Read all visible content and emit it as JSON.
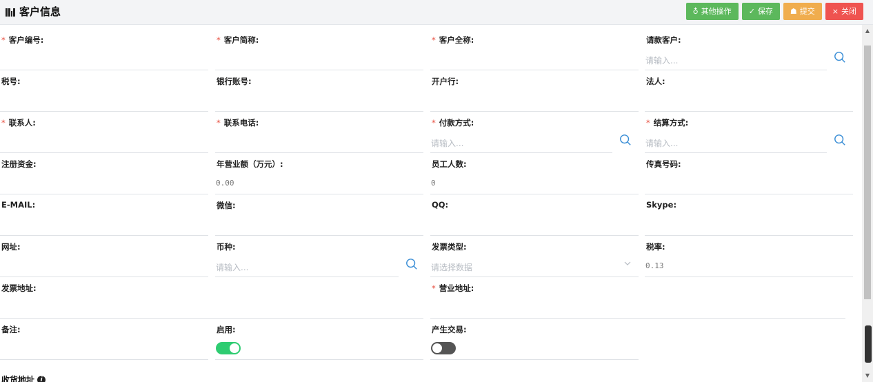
{
  "header": {
    "title": "客户信息",
    "buttons": [
      {
        "name": "other-actions-button",
        "icon": "thumb-icon",
        "glyph": "♁",
        "label": "其他操作",
        "color": "#5cb85c"
      },
      {
        "name": "save-button",
        "icon": "check-icon",
        "glyph": "✓",
        "label": "保存",
        "color": "#5cb85c"
      },
      {
        "name": "submit-button",
        "icon": "doc-icon",
        "glyph": "☗",
        "label": "提交",
        "color": "#f0ad4e"
      },
      {
        "name": "close-button",
        "icon": "close-icon",
        "glyph": "×",
        "label": "关闭",
        "color": "#ef5350"
      }
    ]
  },
  "fields": {
    "customer_code": {
      "label": "客户编号:",
      "required": true
    },
    "customer_short": {
      "label": "客户简称:",
      "required": true
    },
    "customer_full": {
      "label": "客户全称:",
      "required": true
    },
    "billing_customer": {
      "label": "请款客户:",
      "placeholder": "请输入..."
    },
    "tax_no": {
      "label": "税号:"
    },
    "bank_account": {
      "label": "银行账号:"
    },
    "bank": {
      "label": "开户行:"
    },
    "legal_person": {
      "label": "法人:"
    },
    "contact": {
      "label": "联系人:",
      "required": true
    },
    "contact_phone": {
      "label": "联系电话:",
      "required": true
    },
    "payment_method": {
      "label": "付款方式:",
      "required": true,
      "placeholder": "请输入..."
    },
    "settlement_method": {
      "label": "结算方式:",
      "required": true,
      "placeholder": "请输入..."
    },
    "registered_capital": {
      "label": "注册资金:"
    },
    "annual_revenue": {
      "label": "年营业额（万元）:",
      "value": "0.00"
    },
    "employees": {
      "label": "员工人数:",
      "value": "0"
    },
    "fax": {
      "label": "传真号码:"
    },
    "email": {
      "label": "E-MAIL:"
    },
    "wechat": {
      "label": "微信:"
    },
    "qq": {
      "label": "QQ:"
    },
    "skype": {
      "label": "Skype:"
    },
    "website": {
      "label": "网址:"
    },
    "currency": {
      "label": "币种:",
      "placeholder": "请输入..."
    },
    "invoice_type": {
      "label": "发票类型:",
      "placeholder": "请选择数据"
    },
    "tax_rate": {
      "label": "税率:",
      "value": "0.13"
    },
    "invoice_address": {
      "label": "发票地址:"
    },
    "business_address": {
      "label": "营业地址:",
      "required": true
    },
    "remarks": {
      "label": "备注:"
    },
    "enabled": {
      "label": "启用:",
      "on": true
    },
    "produce_trade": {
      "label": "产生交易:",
      "on": false
    }
  },
  "section": {
    "shipping_address": "收货地址"
  },
  "colors": {
    "toggle_on": "#2ecc71",
    "toggle_off": "#555555",
    "search_icon": "#3a8ed6",
    "required": "#e74c3c"
  }
}
